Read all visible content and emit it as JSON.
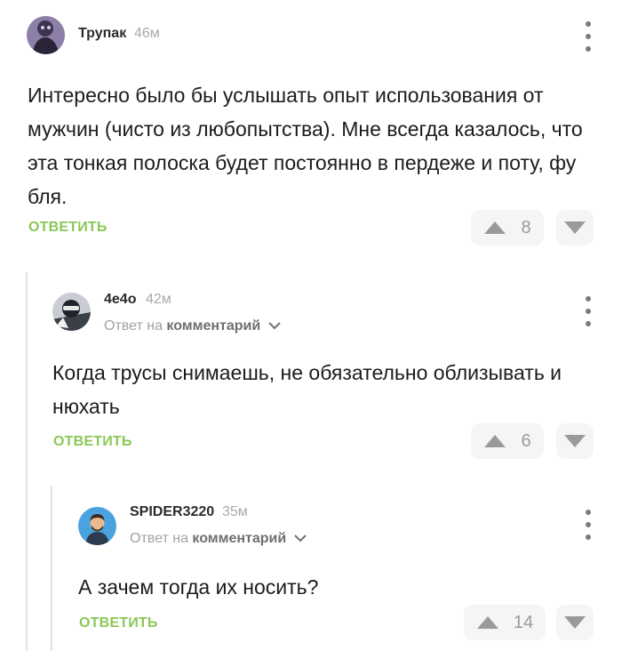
{
  "comments": [
    {
      "author": "Трупак",
      "time": "46м",
      "text": "Интересно было бы услышать опыт использования от мужчин (чисто из любопытства). Мне всегда казалось, что эта тонкая полоска будет постоянно в пердеже и поту, фу бля.",
      "reply_label": "ОТВЕТИТЬ",
      "votes": "8"
    },
    {
      "author": "4e4o",
      "time": "42м",
      "reply_to_prefix": "Ответ на",
      "reply_to_target": "комментарий",
      "text": "Когда трусы снимаешь, не обязательно облизывать и нюхать",
      "reply_label": "ОТВЕТИТЬ",
      "votes": "6"
    },
    {
      "author": "SPIDER3220",
      "time": "35м",
      "reply_to_prefix": "Ответ на",
      "reply_to_target": "комментарий",
      "text": "А зачем тогда их носить?",
      "reply_label": "ОТВЕТИТЬ",
      "votes": "14"
    }
  ],
  "colors": {
    "reply_button": "#8ac858",
    "vote_bg": "#f5f5f5",
    "vote_icon": "#9a9a9a",
    "thread_line": "#e3e3e3"
  },
  "icons": [
    "more-vertical-icon",
    "upvote-triangle-icon",
    "downvote-triangle-icon",
    "chevron-down-icon"
  ]
}
